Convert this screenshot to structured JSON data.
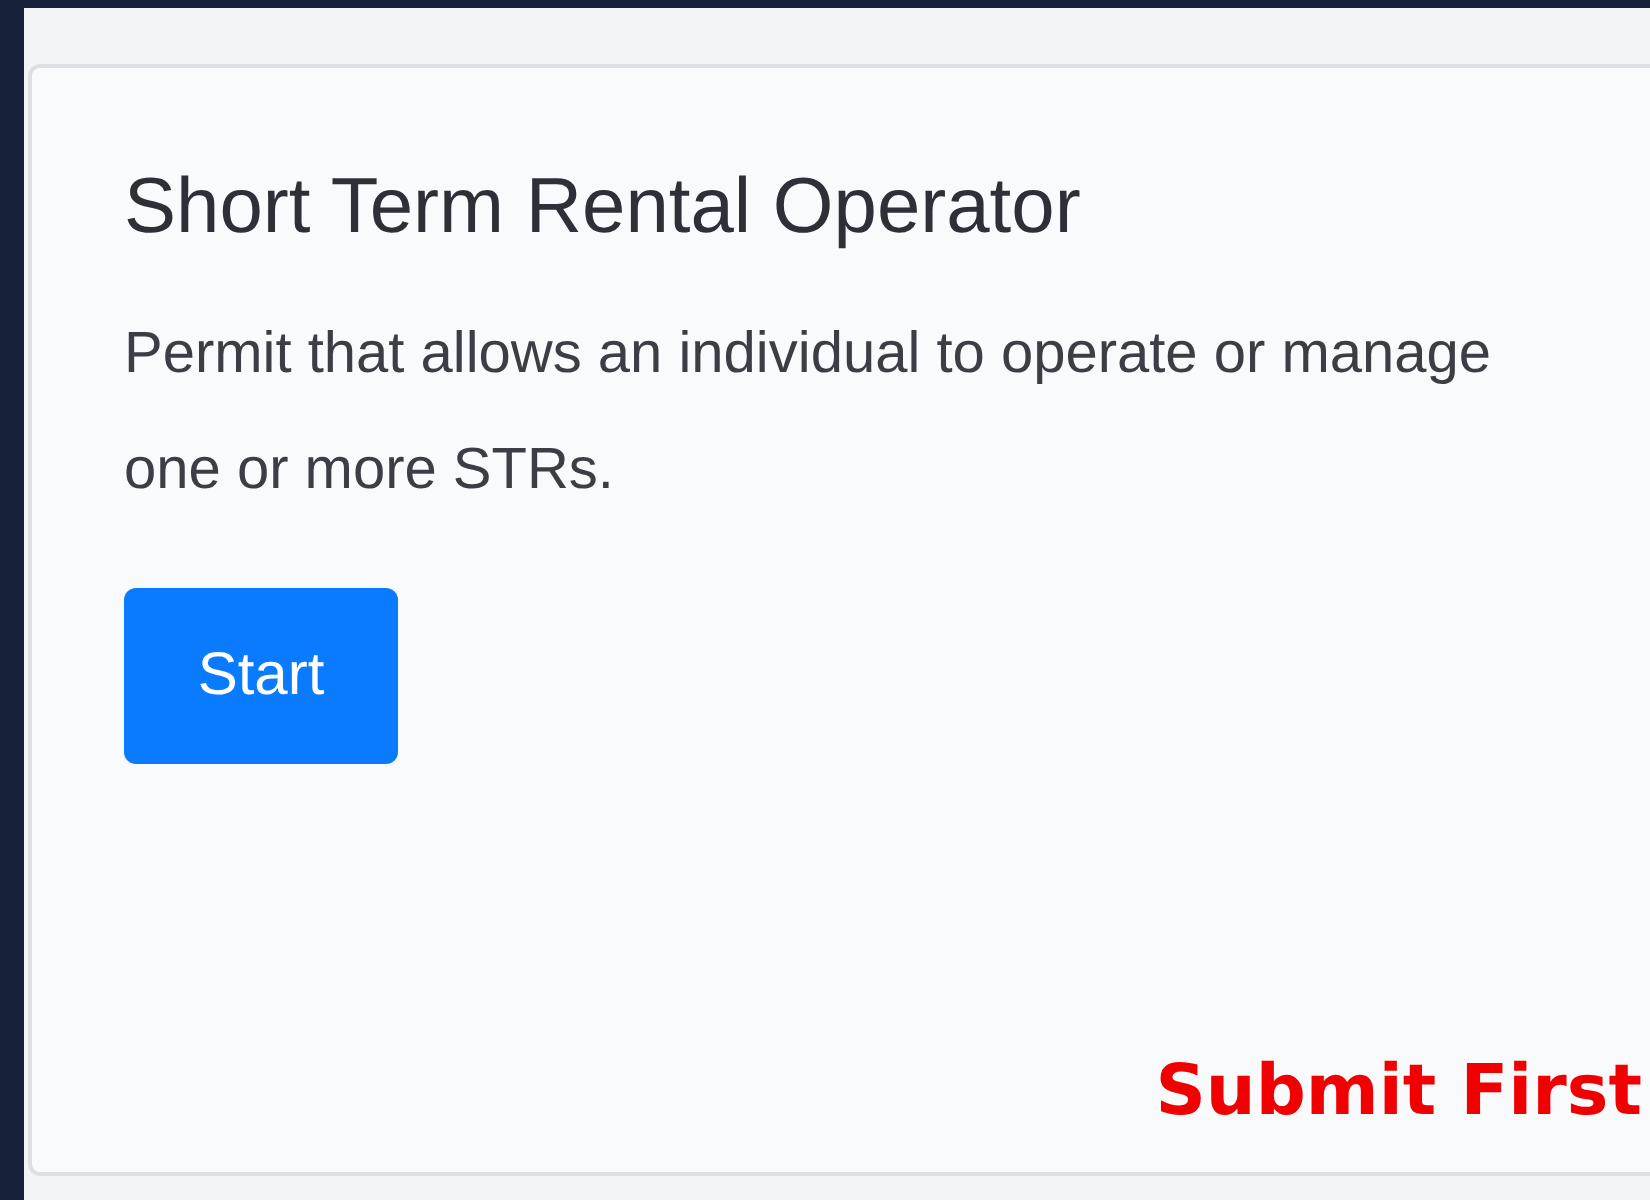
{
  "card": {
    "title": "Short Term Rental Operator",
    "description": "Permit that allows an individual to operate or manage one or more STRs.",
    "button": "Start"
  },
  "annotation": "Submit First"
}
